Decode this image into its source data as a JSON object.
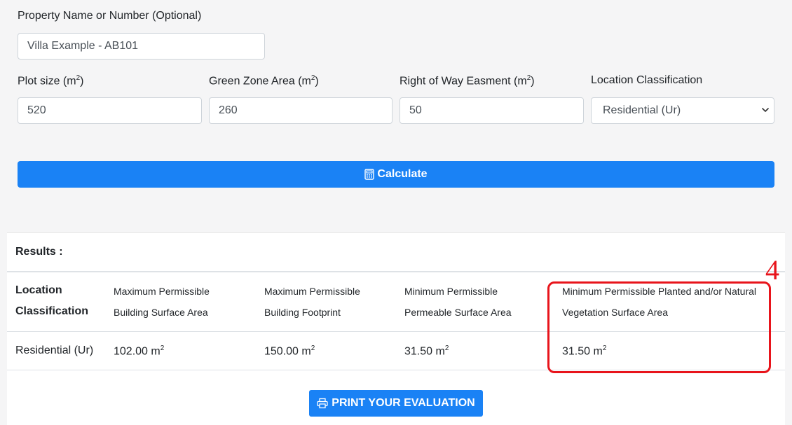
{
  "form": {
    "property_label": "Property Name or Number (Optional)",
    "property_value": "Villa Example - AB101",
    "plot_label": "Plot size (m",
    "green_label": "Green Zone Area (m",
    "row_label": "Right of Way Easment (m",
    "label_sup": "2",
    "label_close": ")",
    "plot_value": "520",
    "green_value": "260",
    "row_value": "50",
    "location_label": "Location Classification",
    "location_value": "Residential (Ur)",
    "calculate_label": "Calculate"
  },
  "results": {
    "title": "Results :",
    "headers": {
      "col1_line1": "Location",
      "col1_line2": "Classification",
      "col2_line1": "Maximum Permissible",
      "col2_line2": "Building Surface Area",
      "col3_line1": "Maximum Permissible",
      "col3_line2": "Building Footprint",
      "col4_line1": "Minimum Permissible",
      "col4_line2": "Permeable Surface Area",
      "col5_line1": "Minimum Permissible Planted and/or Natural",
      "col5_line2": "Vegetation Surface Area"
    },
    "row": {
      "location": "Residential (Ur)",
      "building_surface": "102.00 m",
      "building_footprint": "150.00 m",
      "permeable_surface": "31.50 m",
      "vegetation_surface": "31.50 m",
      "unit_sup": "2"
    },
    "print_label": "PRINT YOUR EVALUATION"
  },
  "annotation": {
    "number": "4",
    "color": "#e8141b"
  },
  "colors": {
    "primary": "#1a82f5",
    "background": "#f5f5f6"
  }
}
